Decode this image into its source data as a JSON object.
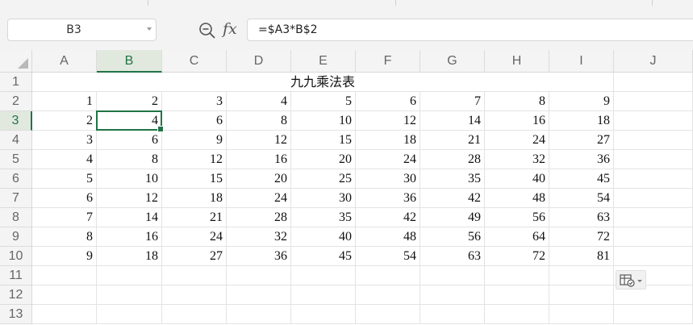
{
  "name_box": {
    "value": "B3"
  },
  "formula_bar": {
    "fx_label": "fx",
    "formula": "=$A3*B$2"
  },
  "columns": [
    "A",
    "B",
    "C",
    "D",
    "E",
    "F",
    "G",
    "H",
    "I",
    "J"
  ],
  "active_column": "B",
  "rows": [
    "1",
    "2",
    "3",
    "4",
    "5",
    "6",
    "7",
    "8",
    "9",
    "10",
    "11",
    "12",
    "13"
  ],
  "active_row": "3",
  "selected_cell": "B3",
  "sheet": {
    "title": "九九乘法表",
    "table": [
      [
        "1",
        "2",
        "3",
        "4",
        "5",
        "6",
        "7",
        "8",
        "9"
      ],
      [
        "2",
        "4",
        "6",
        "8",
        "10",
        "12",
        "14",
        "16",
        "18"
      ],
      [
        "3",
        "6",
        "9",
        "12",
        "15",
        "18",
        "21",
        "24",
        "27"
      ],
      [
        "4",
        "8",
        "12",
        "16",
        "20",
        "24",
        "28",
        "32",
        "36"
      ],
      [
        "5",
        "10",
        "15",
        "20",
        "25",
        "30",
        "35",
        "40",
        "45"
      ],
      [
        "6",
        "12",
        "18",
        "24",
        "30",
        "36",
        "42",
        "48",
        "54"
      ],
      [
        "7",
        "14",
        "21",
        "28",
        "35",
        "42",
        "49",
        "56",
        "63"
      ],
      [
        "8",
        "16",
        "24",
        "32",
        "40",
        "48",
        "56",
        "64",
        "72"
      ],
      [
        "9",
        "18",
        "27",
        "36",
        "45",
        "54",
        "63",
        "72",
        "81"
      ]
    ]
  },
  "icons": {
    "zoom": "zoom-formula-icon",
    "paste_options": "paste-options-icon"
  },
  "colors": {
    "accent": "#217346"
  }
}
